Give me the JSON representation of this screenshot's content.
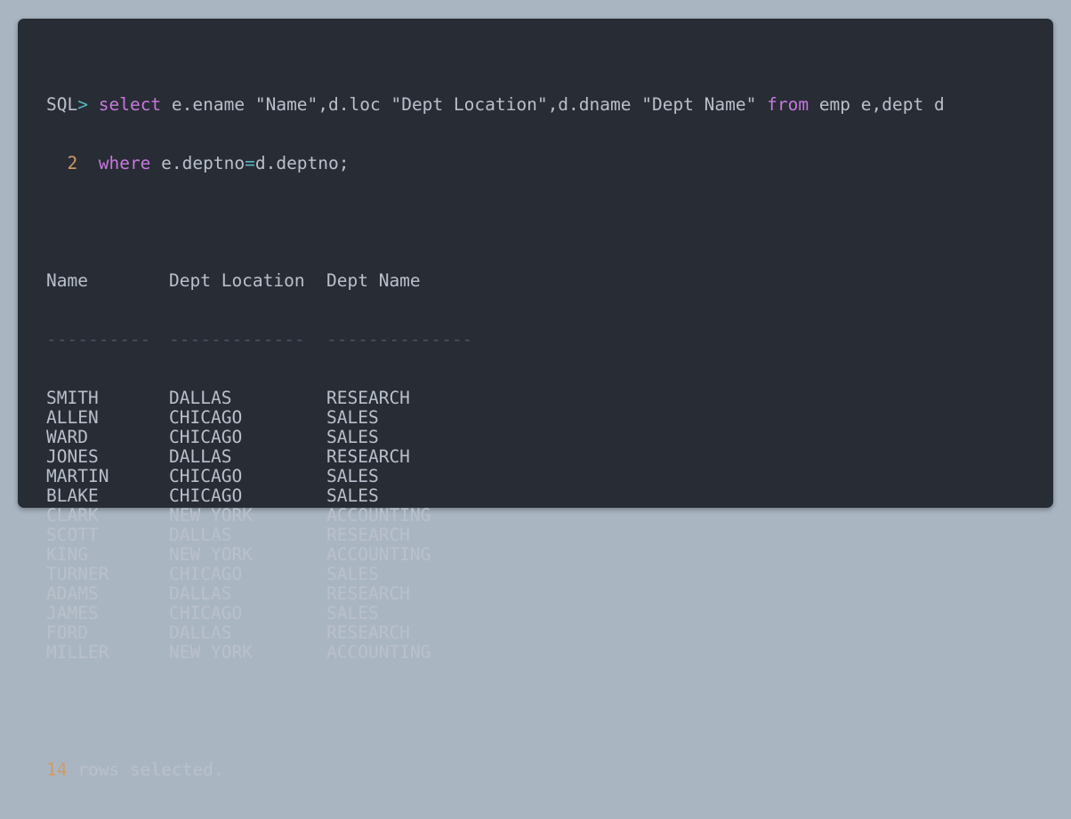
{
  "colors": {
    "background": "#a9b6c2",
    "terminal_bg": "#282c34",
    "text": "#b9c0cb",
    "keyword": "#c678dd",
    "operator": "#56b6c2",
    "number": "#d19a66",
    "underline": "#4b5263"
  },
  "command": {
    "prompt": "SQL",
    "prompt_symbol": ">",
    "line1": {
      "kw_select": "select",
      "part1": " e.ename \"Name\",d.loc \"Dept Location\",d.dname \"Dept Name\" ",
      "kw_from": "from",
      "part2": " emp e,dept d"
    },
    "line2": {
      "line_number": "2",
      "kw_where": "where",
      "left": "e.deptno",
      "op": "=",
      "right": "d.deptno;"
    }
  },
  "result": {
    "headers": [
      "Name",
      "Dept Location",
      "Dept Name"
    ],
    "underlines": [
      "----------",
      "-------------",
      "--------------"
    ],
    "rows": [
      [
        "SMITH",
        "DALLAS",
        "RESEARCH"
      ],
      [
        "ALLEN",
        "CHICAGO",
        "SALES"
      ],
      [
        "WARD",
        "CHICAGO",
        "SALES"
      ],
      [
        "JONES",
        "DALLAS",
        "RESEARCH"
      ],
      [
        "MARTIN",
        "CHICAGO",
        "SALES"
      ],
      [
        "BLAKE",
        "CHICAGO",
        "SALES"
      ],
      [
        "CLARK",
        "NEW YORK",
        "ACCOUNTING"
      ],
      [
        "SCOTT",
        "DALLAS",
        "RESEARCH"
      ],
      [
        "KING",
        "NEW YORK",
        "ACCOUNTING"
      ],
      [
        "TURNER",
        "CHICAGO",
        "SALES"
      ],
      [
        "ADAMS",
        "DALLAS",
        "RESEARCH"
      ],
      [
        "JAMES",
        "CHICAGO",
        "SALES"
      ],
      [
        "FORD",
        "DALLAS",
        "RESEARCH"
      ],
      [
        "MILLER",
        "NEW YORK",
        "ACCOUNTING"
      ]
    ],
    "count": "14",
    "count_suffix": " rows selected."
  }
}
